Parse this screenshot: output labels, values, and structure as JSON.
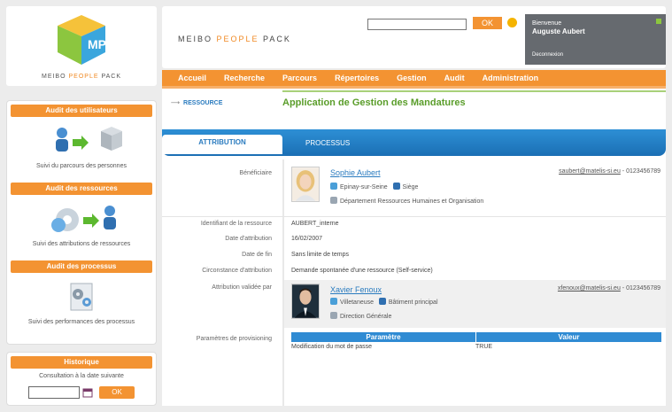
{
  "brand": {
    "logo_initials": "MP",
    "logo_text_a": "MEIBO ",
    "logo_text_b": "PEOPLE",
    "logo_text_c": " PACK",
    "app_name_a": "MEIBO ",
    "app_name_b": "PEOPLE",
    "app_name_c": " PACK",
    "accent_color": "#f39332"
  },
  "search": {
    "value": "",
    "ok_label": "OK"
  },
  "user": {
    "greeting": "Bienvenue",
    "name": "Auguste Aubert",
    "logout": "Deconnexion"
  },
  "nav": {
    "items": [
      "Accueil",
      "Recherche",
      "Parcours",
      "Répertoires",
      "Gestion",
      "Audit",
      "Administration"
    ]
  },
  "sidebar": {
    "audit_users": {
      "title": "Audit des utilisateurs",
      "caption": "Suivi du parcours des personnes"
    },
    "audit_resources": {
      "title": "Audit des ressources",
      "caption": "Suivi des attributions de ressources"
    },
    "audit_processes": {
      "title": "Audit des processus",
      "caption": "Suivi des performances des processus"
    },
    "history": {
      "title": "Historique",
      "caption": "Consultation à la date suivante",
      "date_value": "",
      "ok_label": "OK"
    }
  },
  "page": {
    "breadcrumb": "RESSOURCE",
    "title": "Application de Gestion des Mandatures",
    "tabs": [
      "ATTRIBUTION",
      "PROCESSUS"
    ]
  },
  "beneficiary": {
    "label": "Bénéficiaire",
    "name": "Sophie  Aubert ",
    "email": "saubert@matelis-si.eu",
    "phone": " - 0123456789",
    "city": "Epinay-sur-Seine",
    "site": "Siège",
    "department": "Département Ressources Humaines et Organisation"
  },
  "fields": [
    {
      "label": "Identifiant de la ressource",
      "value": "AUBERT_interne"
    },
    {
      "label": "Date d'attribution",
      "value": "16/02/2007"
    },
    {
      "label": "Date de fin",
      "value": "Sans limite de temps"
    },
    {
      "label": "Circonstance d'attribution",
      "value": "Demande spontanée d'une ressource (Self-service)"
    }
  ],
  "validator": {
    "label": "Attribution validée par",
    "name": "Xavier Fenoux",
    "email": "xfenoux@matelis-si.eu",
    "phone": " - 0123456789",
    "city": "Villetaneuse",
    "site": "Bâtiment principal",
    "department": "Direction Générale"
  },
  "provisioning": {
    "label": "Paramètres de provisioning",
    "headers": [
      "Paramètre",
      "Valeur"
    ],
    "rows": [
      {
        "param": "Modification du mot de passe",
        "value": "TRUE"
      }
    ]
  }
}
